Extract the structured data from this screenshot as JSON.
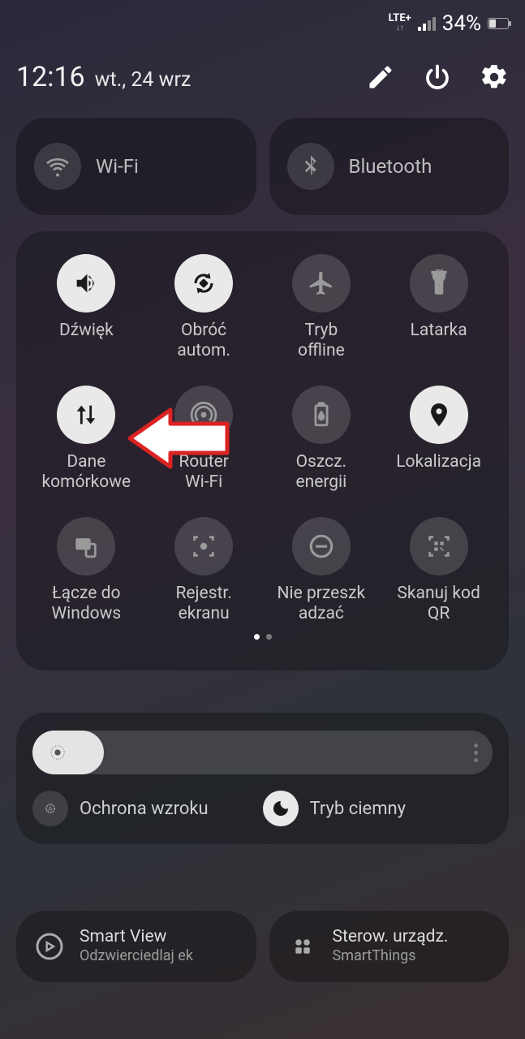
{
  "status": {
    "network_type": "LTE+",
    "battery_text": "34%"
  },
  "header": {
    "time": "12:16",
    "date": "wt., 24 wrz"
  },
  "conn": {
    "wifi": "Wi-Fi",
    "bluetooth": "Bluetooth"
  },
  "tiles": [
    {
      "id": "sound",
      "label": "Dźwięk",
      "active": true
    },
    {
      "id": "rotate",
      "label": "Obróć\nautom.",
      "active": true
    },
    {
      "id": "airplane",
      "label": "Tryb\noffline",
      "active": false
    },
    {
      "id": "flashlight",
      "label": "Latarka",
      "active": false
    },
    {
      "id": "mobiledata",
      "label": "Dane\nkomórkowe",
      "active": true
    },
    {
      "id": "hotspot",
      "label": "Router\nWi-Fi",
      "active": false
    },
    {
      "id": "powersave",
      "label": "Oszcz.\nenergii",
      "active": false
    },
    {
      "id": "location",
      "label": "Lokalizacja",
      "active": true
    },
    {
      "id": "linkwindows",
      "label": "Łącze do\nWindows",
      "active": false
    },
    {
      "id": "screenrecord",
      "label": "Rejestr.\nekranu",
      "active": false
    },
    {
      "id": "dnd",
      "label": "Nie przeszk\nadzać",
      "active": false
    },
    {
      "id": "qrscan",
      "label": "Skanuj kod\nQR",
      "active": false
    }
  ],
  "display": {
    "eye_comfort": "Ochrona wzroku",
    "dark_mode": "Tryb ciemny"
  },
  "bottom": {
    "smartview_title": "Smart View",
    "smartview_sub": "Odzwierciedlaj ek",
    "devices_title": "Sterow. urządz.",
    "devices_sub": "SmartThings"
  }
}
